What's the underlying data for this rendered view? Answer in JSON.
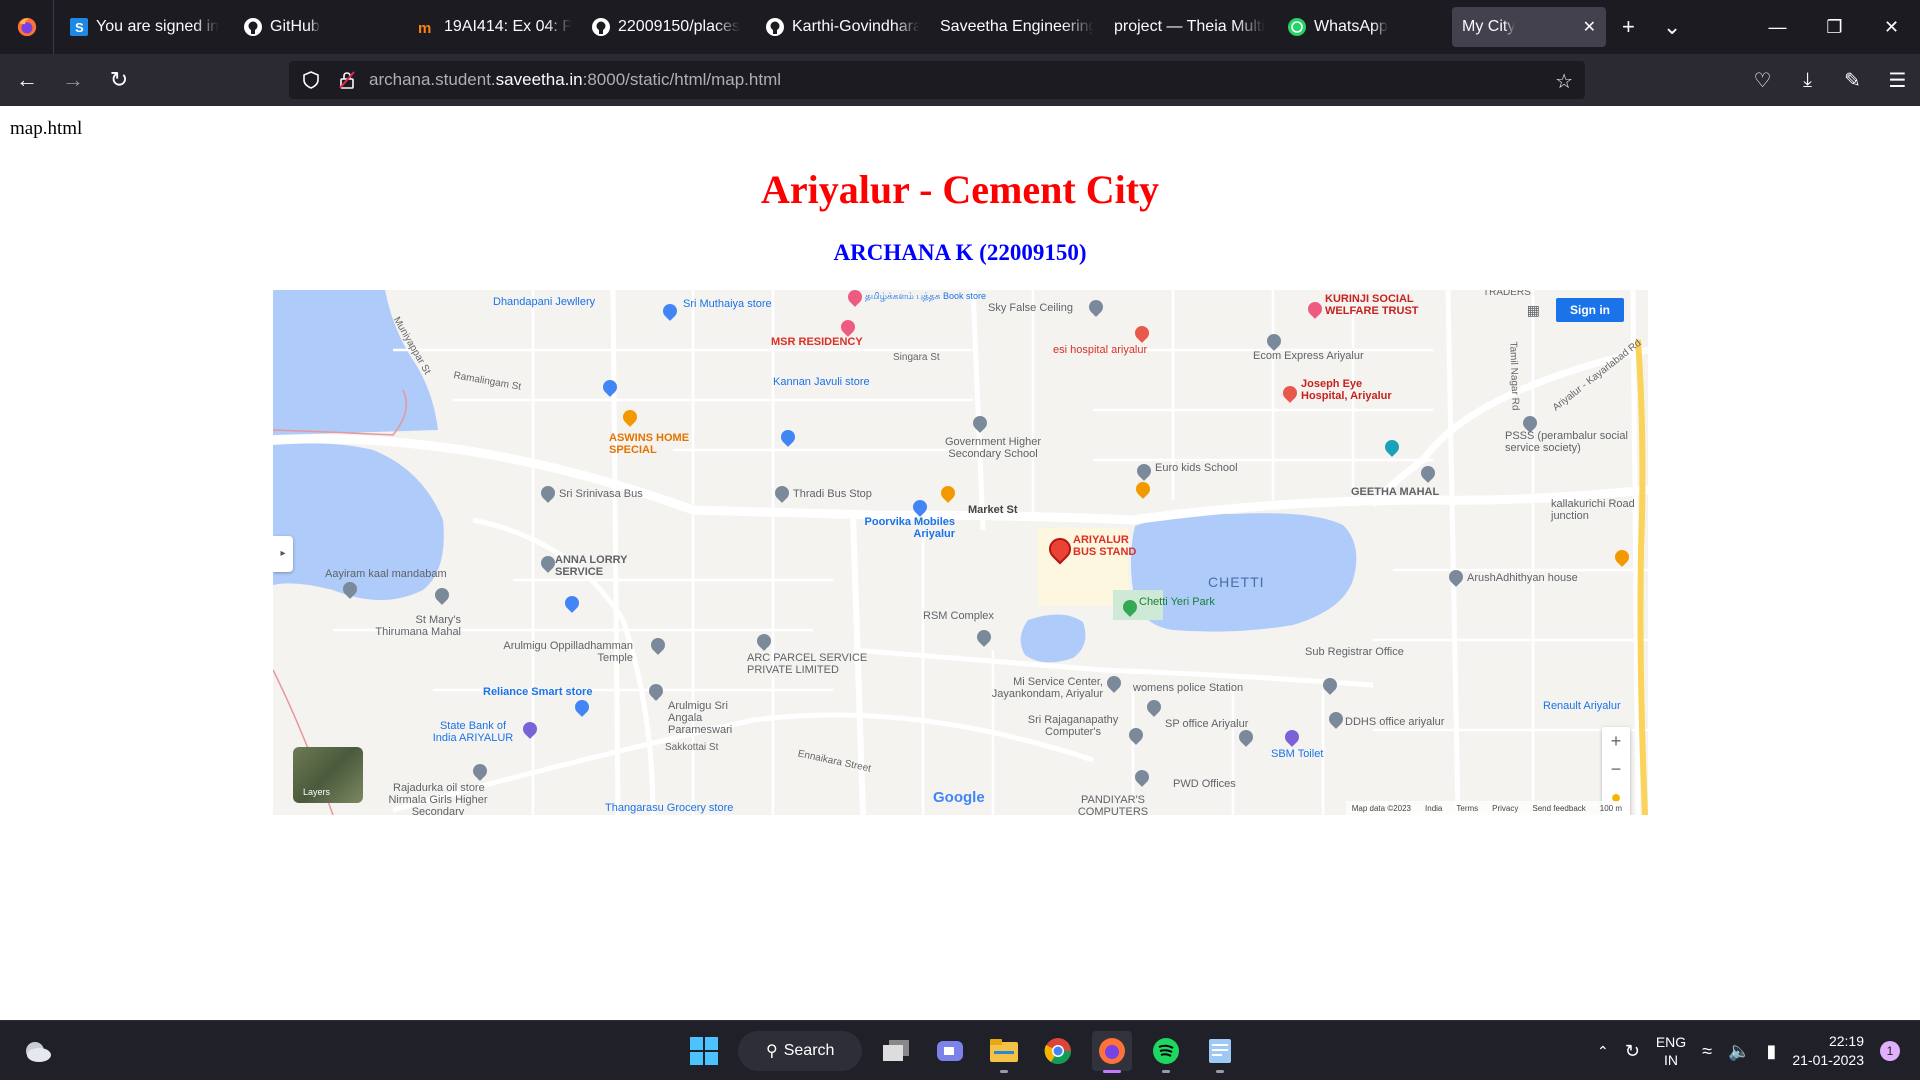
{
  "browser": {
    "tabs": [
      {
        "label": "You are signed in",
        "icon": "saveetha-s-icon"
      },
      {
        "label": "GitHub",
        "icon": "github-icon"
      },
      {
        "label": "19AI414: Ex 04: Pl",
        "icon": "moodle-icon"
      },
      {
        "label": "22009150/places",
        "icon": "github-icon"
      },
      {
        "label": "Karthi-Govindhara",
        "icon": "github-icon"
      },
      {
        "label": "Saveetha Engineering",
        "icon": "none"
      },
      {
        "label": "project — Theia Multi",
        "icon": "none"
      },
      {
        "label": "WhatsApp",
        "icon": "whatsapp-icon"
      }
    ],
    "active_tab": {
      "label": "My City",
      "close": "✕"
    },
    "new_tab": "+",
    "tab_list": "⌄",
    "url_muted_prefix": "archana.student.",
    "url_domain": "saveetha.in",
    "url_suffix": ":8000/static/html/map.html"
  },
  "page": {
    "filename_text": "map.html",
    "title": "Ariyalur - Cement City",
    "subtitle": "ARCHANA K (22009150)"
  },
  "map": {
    "sign_in": "Sign in",
    "layers": "Layers",
    "google": "Google",
    "lake_name": "CHETTI",
    "footer": [
      "Map data ©2023",
      "India",
      "Terms",
      "Privacy",
      "Send feedback",
      "100 m"
    ],
    "main_pin_label": "ARIYALUR\nBUS STAND",
    "labels": {
      "dhandapani": "Dhandapani Jewllery",
      "muthaiya": "Sri Muthaiya store",
      "book_store": "தமிழ்க்களம் புத்தக Book store",
      "sky_false": "Sky False Ceiling",
      "kurinji": "KURINJI SOCIAL WELFARE TRUST",
      "traders": "TRADERS",
      "msr": "MSR RESIDENCY",
      "singara": "Singara St",
      "esi": "esi hospital ariyalur",
      "ecom": "Ecom Express Ariyalur",
      "ramalingam": "Ramalingam St",
      "kannan": "Kannan Javuli store",
      "joseph": "Joseph Eye Hospital, Ariyalur",
      "aswins": "ASWINS HOME SPECIAL",
      "govt_school": "Government Higher Secondary School",
      "pssss": "PSSS (perambalur social service society)",
      "euro_kids": "Euro kids School",
      "geetha": "GEETHA MAHAL",
      "srinivasa": "Sri Srinivasa Bus",
      "thradi": "Thradi Bus Stop",
      "market": "Market St",
      "kallakurichi": "kallakurichi Road junction",
      "poorvika": "Poorvika Mobiles Ariyalur",
      "anna_lorry": "ANNA LORRY SERVICE",
      "aayiram": "Aayiram kaal mandabam",
      "arush": "ArushAdhithyan house",
      "chetti_park": "Chetti Yeri Park",
      "st_marys": "St Mary's Thirumana Mahal",
      "rsm": "RSM Complex",
      "arulmigu": "Arulmigu Oppilladhamman Temple",
      "arc_parcel": "ARC PARCEL SERVICE PRIVATE LIMITED",
      "sub_registrar": "Sub Registrar Office",
      "reliance": "Reliance Smart store",
      "mi_service": "Mi Service Center, Jayankondam, Ariyalur",
      "womens": "womens police Station",
      "renault": "Renault Ariyalur",
      "angala": "Arulmigu Sri Angala Parameswari",
      "sbi": "State Bank of India ARIYALUR",
      "sakkottai": "Sakkottai St",
      "rajaganapathy": "Sri Rajaganapathy Computer's",
      "sp_office": "SP office Ariyalur",
      "ddhs": "DDHS office ariyalur",
      "sbm": "SBM Toilet",
      "rajadurka": "Rajadurka oil store",
      "nirmala": "Nirmala Girls Higher Secondary",
      "ennaikara": "Ennaikara Street",
      "pwd": "PWD Offices",
      "pandiyars": "PANDIYAR'S COMPUTERS",
      "thangarasu": "Thangarasu Grocery store",
      "munyappar": "Muniyappar St",
      "tamil_nagar": "Tamil Nagar Rd",
      "kayarlabad": "Ariyalur - Kayarlabad Rd"
    }
  },
  "taskbar": {
    "search": "Search",
    "lang_1": "ENG",
    "lang_2": "IN",
    "time": "22:19",
    "date": "21-01-2023",
    "badge": "1"
  }
}
